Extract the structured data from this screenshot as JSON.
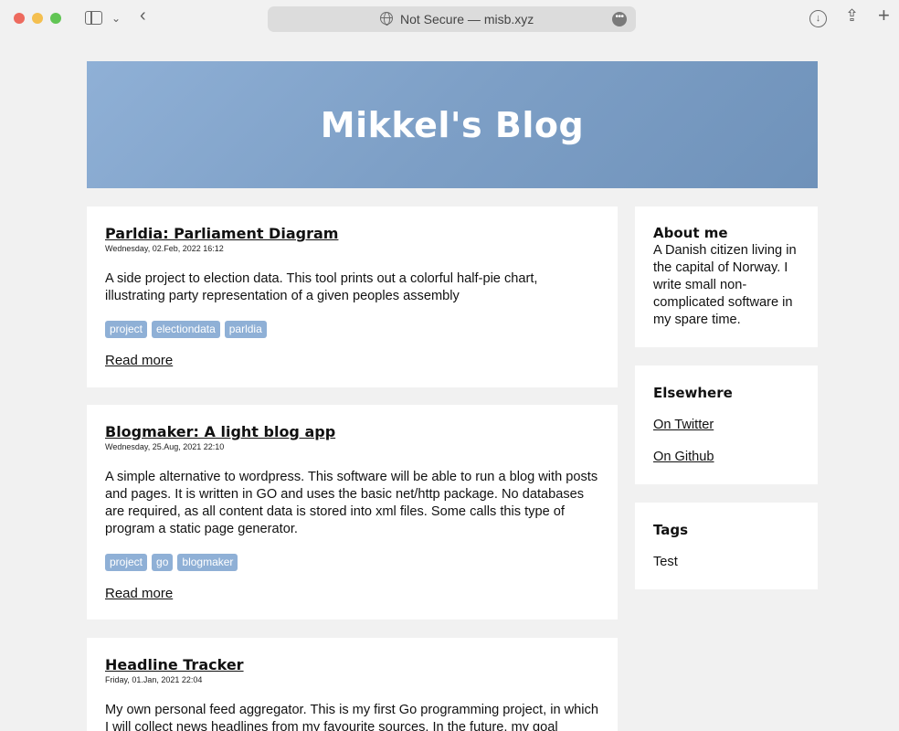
{
  "browser": {
    "url_text": "Not Secure — misb.xyz",
    "icons": [
      "sidebar-icon",
      "chevron-down-icon",
      "back-icon",
      "globe-icon",
      "more-icon",
      "download-icon",
      "share-icon",
      "plus-icon"
    ]
  },
  "blog": {
    "title": "Mikkel's Blog",
    "banner_color": "#7d9fc6",
    "tag_color": "#8fb0d6"
  },
  "posts": [
    {
      "title": "Parldia: Parliament Diagram",
      "date": "Wednesday, 02.Feb, 2022 16:12",
      "body": "A side project to election data. This tool prints out a colorful half-pie chart, illustrating party representation of a given peoples assembly",
      "tags": [
        "project",
        "electiondata",
        "parldia"
      ],
      "read_more": "Read more"
    },
    {
      "title": "Blogmaker: A light blog app",
      "date": "Wednesday, 25.Aug, 2021 22:10",
      "body": "A simple alternative to wordpress. This software will be able to run a blog with posts and pages. It is written in GO and uses the basic net/http package. No databases are required, as all content data is stored into xml files. Some calls this type of program a static page generator.",
      "tags": [
        "project",
        "go",
        "blogmaker"
      ],
      "read_more": "Read more"
    },
    {
      "title": "Headline Tracker",
      "date": "Friday, 01.Jan, 2021 22:04",
      "body": "My own personal feed aggregator. This is my first Go programming project, in which I will collect news headlines from my favourite sources. In the future, my goal"
    }
  ],
  "sidebar": {
    "about": {
      "title": "About me",
      "text": "A Danish citizen living in the capital of Norway. I write small non-complicated software in my spare time."
    },
    "elsewhere": {
      "title": "Elsewhere",
      "links": [
        "On Twitter",
        "On Github"
      ]
    },
    "tags": {
      "title": "Tags",
      "items": [
        "Test"
      ]
    }
  }
}
